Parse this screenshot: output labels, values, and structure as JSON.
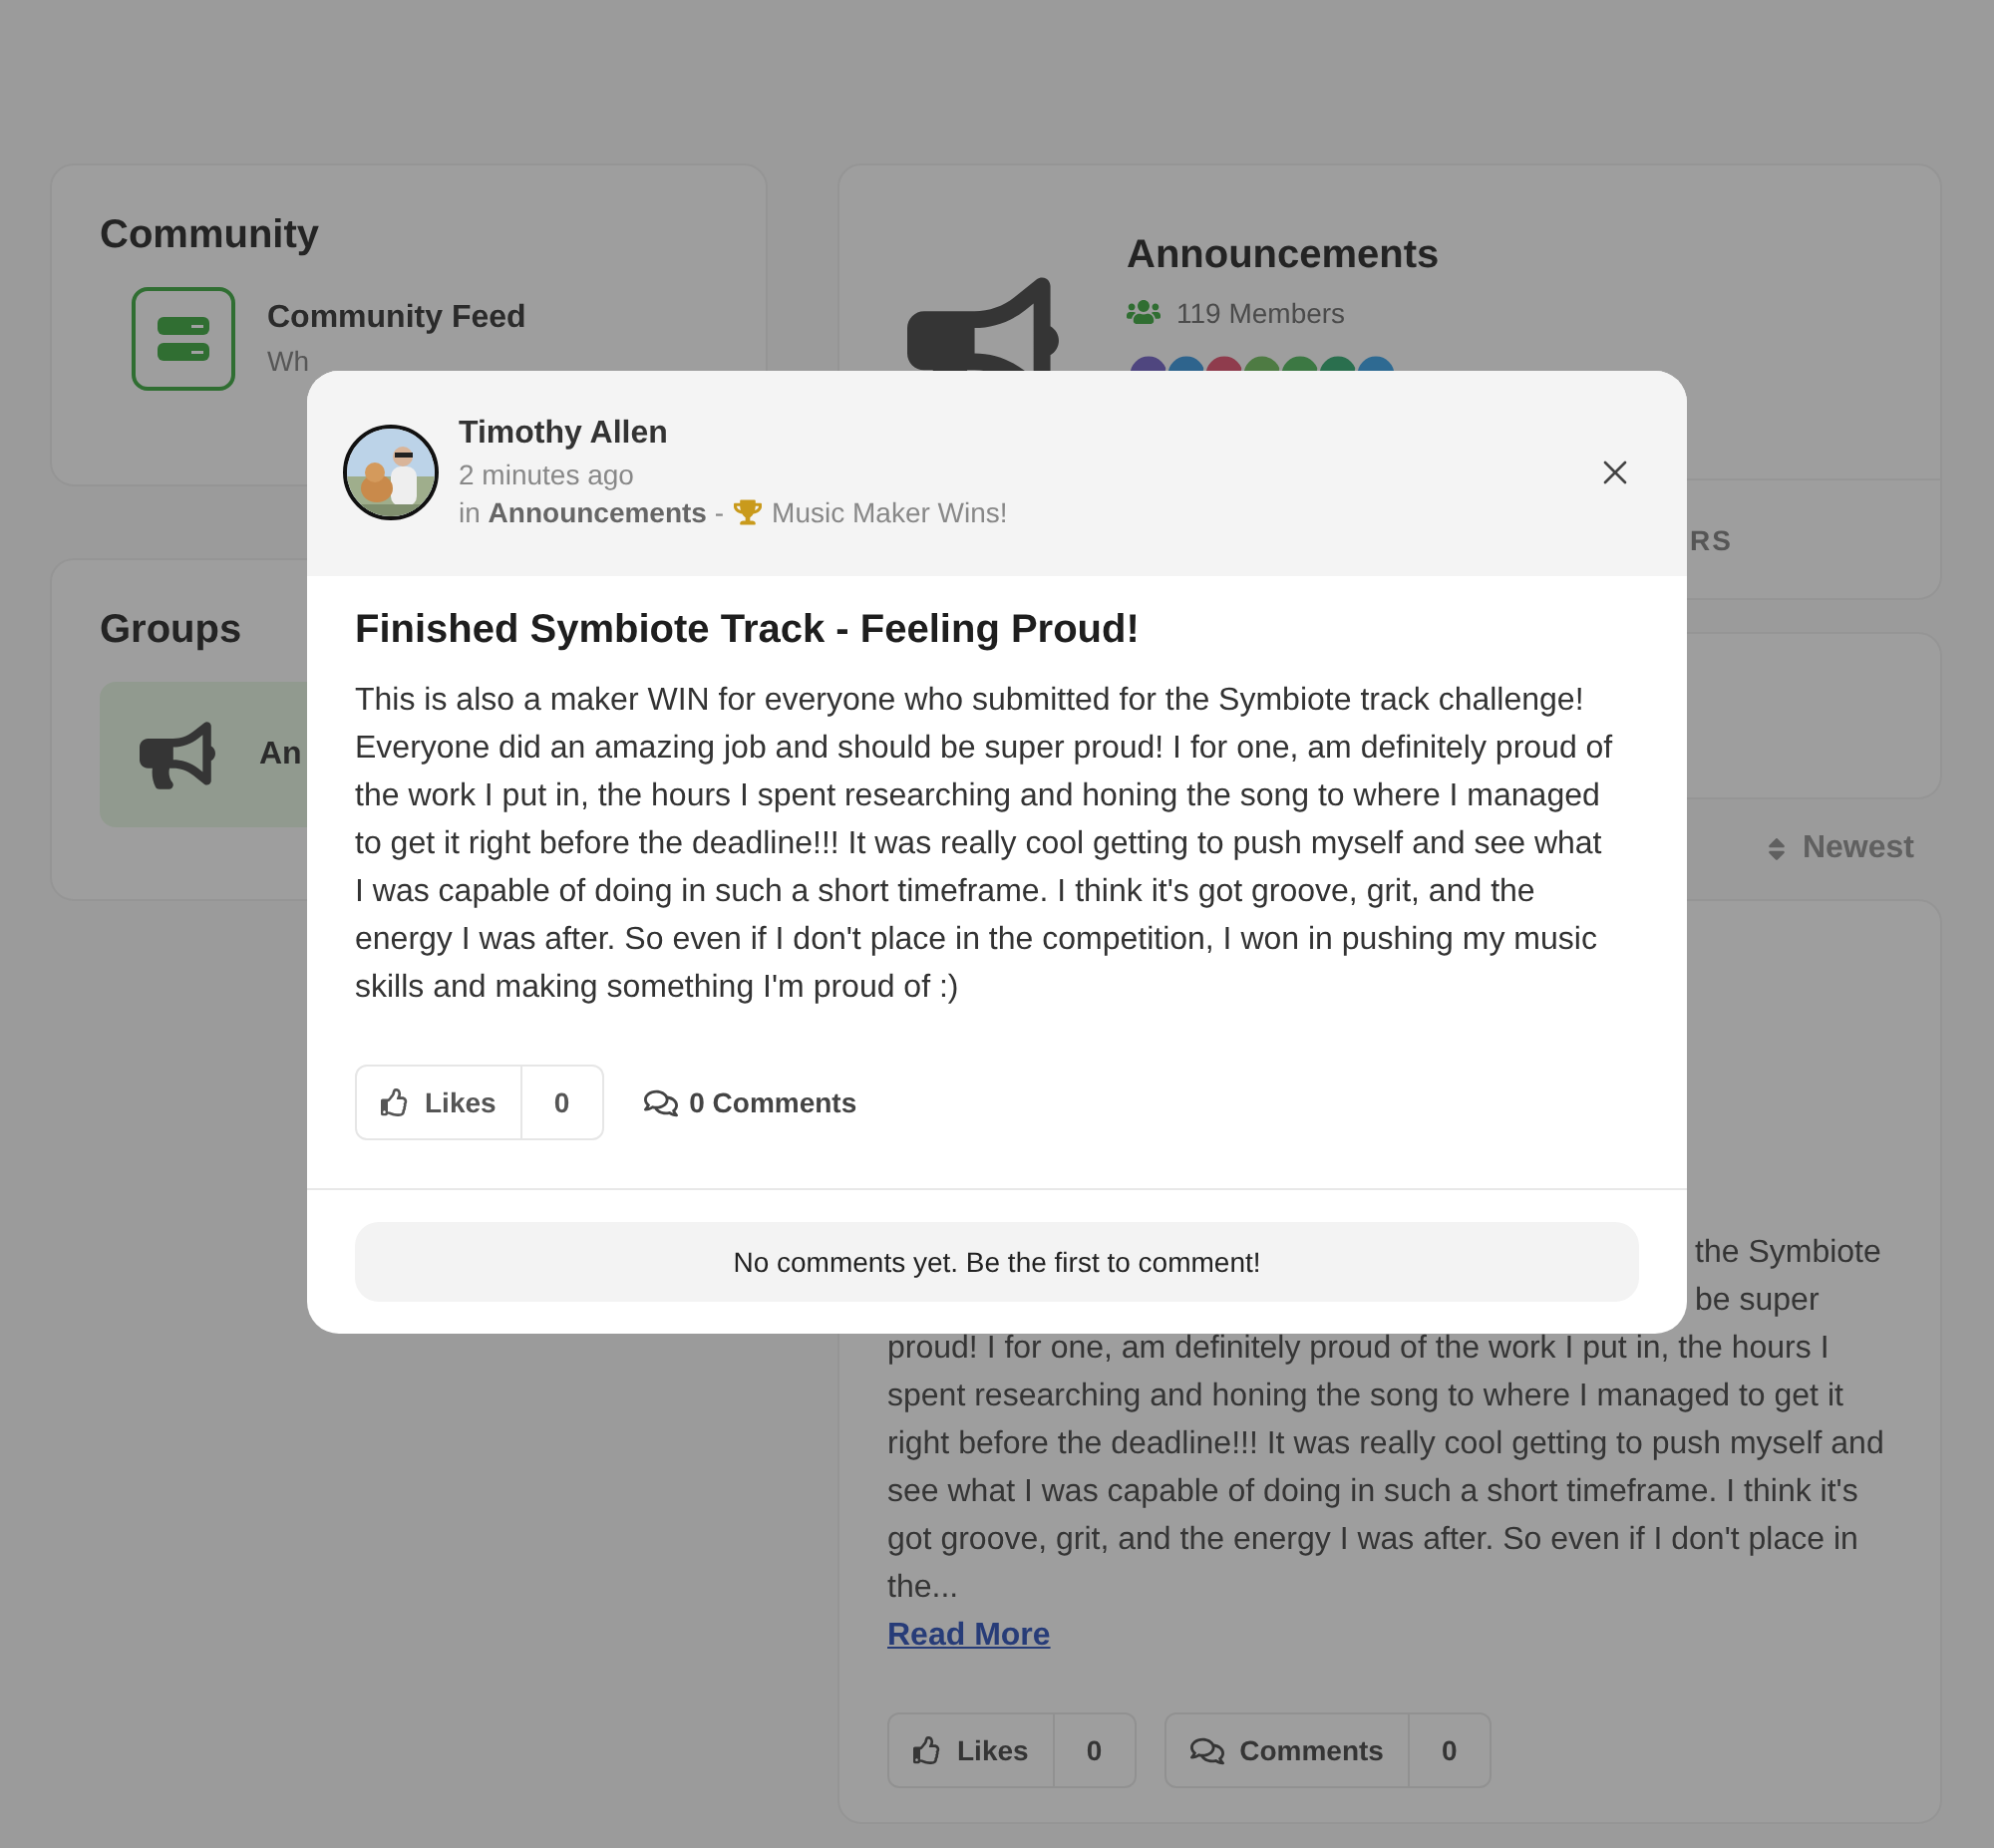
{
  "page": {
    "community": {
      "title": "Community",
      "items": [
        {
          "name": "Community Feed",
          "description": "Wh"
        }
      ]
    },
    "groups": {
      "title": "Groups",
      "items": [
        {
          "name": "An",
          "selected": true
        }
      ]
    },
    "group_header": {
      "name": "Announcements",
      "members": "119 Members",
      "tabs": [
        {
          "label": "RS"
        }
      ]
    },
    "sort": {
      "label": "Newest"
    },
    "post": {
      "visible_fragments": [
        "the Symbiote",
        "be super"
      ],
      "body": "proud! I for one, am definitely proud of the work I put in, the hours I spent researching and honing the song to where I managed to get it right before the deadline!!! It was really cool getting to push myself and see what I was capable of doing in such a short timeframe. I think it's got groove, grit, and the energy I was after. So even if I don't place in the...",
      "read_more": "Read More",
      "likes": {
        "label": "Likes",
        "count": "0"
      },
      "comments": {
        "label": "Comments",
        "count": "0"
      }
    }
  },
  "modal": {
    "author": "Timothy Allen",
    "time": "2 minutes ago",
    "context": "in **Announcements** -",
    "badge": "Music Maker Wins!",
    "title": "Finished Symbiote Track - Feeling Proud!",
    "body": "This is also a maker WIN for everyone who submitted for the Symbiote track challenge! Everyone did an amazing job and should be super proud! I for one, am definitely proud of the work I put in, the hours I spent researching and honing the song to where I managed to get it right before the deadline!!! It was really cool getting to push myself and see what I was capable of doing in such a short timeframe. I think it's got groove, grit, and the energy I was after. So even if I don't place in the competition, I won in pushing my music skills and making something I'm proud of :)",
    "likes": {
      "label": "Likes",
      "count": "0"
    },
    "comments": "0 Comments",
    "empty_comments": "No comments yet. Be the first to comment!"
  }
}
